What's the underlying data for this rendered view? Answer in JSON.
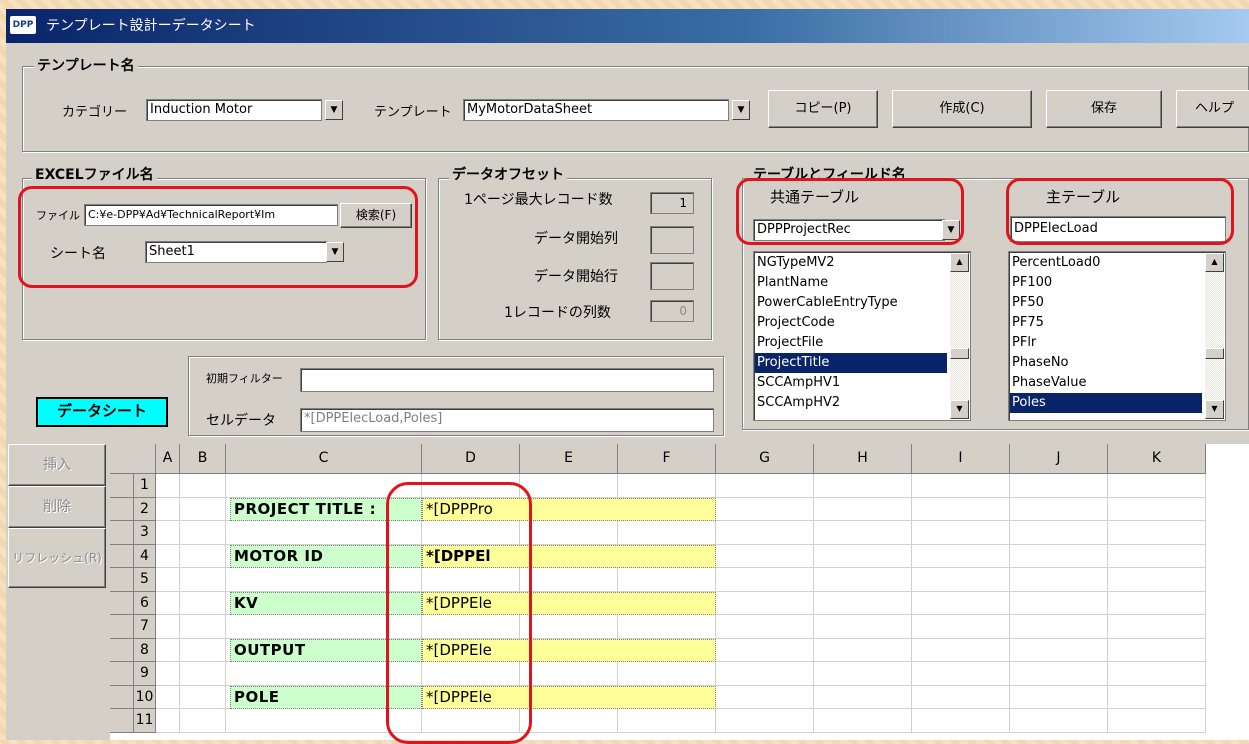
{
  "window": {
    "title": "テンプレート設計ーデータシート",
    "logo": "DPP"
  },
  "template_group": {
    "legend": "テンプレート名",
    "category_label": "カテゴリー",
    "category_value": "Induction Motor",
    "template_label": "テンプレート",
    "template_value": "MyMotorDataSheet",
    "buttons": {
      "copy": "コピー(P)",
      "create": "作成(C)",
      "save": "保存",
      "help": "ヘルプ"
    }
  },
  "excel_group": {
    "legend": "EXCELファイル名",
    "file_label": "ファイル",
    "file_value": "C:¥e-DPP¥Ad¥TechnicalReport¥Im",
    "search_button": "検索(F)",
    "sheet_label": "シート名",
    "sheet_value": "Sheet1"
  },
  "offset_group": {
    "legend": "データオフセット",
    "max_records_label": "1ページ最大レコード数",
    "max_records_value": "1",
    "start_col_label": "データ開始列",
    "start_col_value": "",
    "start_row_label": "データ開始行",
    "start_row_value": "",
    "cols_per_record_label": "1レコードの列数",
    "cols_per_record_value": "0"
  },
  "table_group": {
    "legend": "テーブルとフィールド名",
    "common_label": "共通テーブル",
    "common_value": "DPPProjectRec",
    "common_fields": [
      "NGTypeMV2",
      "PlantName",
      "PowerCableEntryType",
      "ProjectCode",
      "ProjectFile",
      "ProjectTitle",
      "SCCAmpHV1",
      "SCCAmpHV2"
    ],
    "common_selected": "ProjectTitle",
    "main_label": "主テーブル",
    "main_value": "DPPElecLoad",
    "main_fields": [
      "PercentLoad0",
      "PF100",
      "PF50",
      "PF75",
      "PFlr",
      "PhaseNo",
      "PhaseValue",
      "Poles"
    ],
    "main_selected": "Poles"
  },
  "filter": {
    "initial_filter_label": "初期フィルター",
    "initial_filter_value": "",
    "cell_data_label": "セルデータ",
    "cell_data_value": "*[DPPElecLoad,Poles]"
  },
  "datasheet_label": "データシート",
  "side_buttons": {
    "insert": "挿入",
    "delete": "削除",
    "refresh": "リフレッシュ(R)"
  },
  "sheet": {
    "columns": [
      "A",
      "B",
      "C",
      "D",
      "E",
      "F",
      "G",
      "H",
      "I",
      "J",
      "K"
    ],
    "rows": [
      "1",
      "2",
      "3",
      "4",
      "5",
      "6",
      "7",
      "8",
      "9",
      "10",
      "11"
    ],
    "labels": [
      {
        "row": "2",
        "text": "PROJECT TITLE :"
      },
      {
        "row": "4",
        "text": "MOTOR ID"
      },
      {
        "row": "6",
        "text": "KV"
      },
      {
        "row": "8",
        "text": "OUTPUT"
      },
      {
        "row": "10",
        "text": "POLE"
      }
    ],
    "values": [
      {
        "row": "2",
        "text": "*[DPPPro"
      },
      {
        "row": "4",
        "text": "*[DPPEl"
      },
      {
        "row": "6",
        "text": "*[DPPEle"
      },
      {
        "row": "8",
        "text": "*[DPPEle"
      },
      {
        "row": "10",
        "text": "*[DPPEle"
      }
    ]
  },
  "colors": {
    "highlight_red": "#e0141e",
    "label_green": "#ccffcc",
    "value_yellow": "#ffff99",
    "datasheet_cyan": "#00ffff",
    "selection_navy": "#0a246a"
  }
}
